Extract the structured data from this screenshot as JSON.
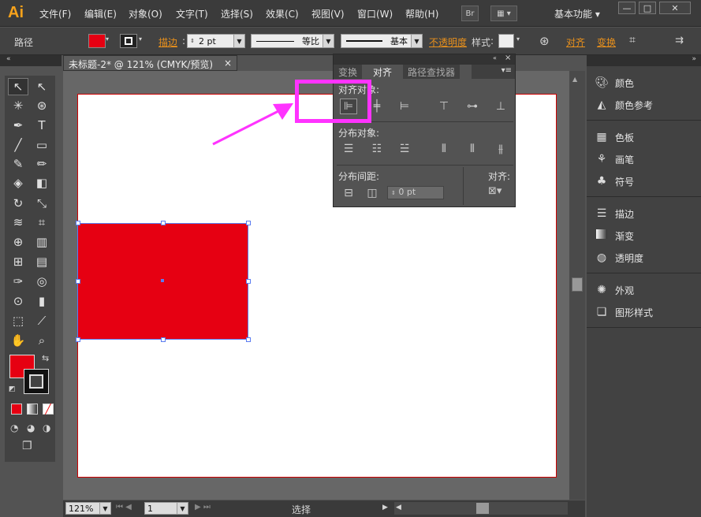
{
  "menubar": {
    "logo": "Ai",
    "menus": [
      "文件(F)",
      "编辑(E)",
      "对象(O)",
      "文字(T)",
      "选择(S)",
      "效果(C)",
      "视图(V)",
      "窗口(W)",
      "帮助(H)"
    ],
    "bridge_label": "Br",
    "workspace": "基本功能",
    "window_controls": [
      "—",
      "□",
      "✕"
    ]
  },
  "control_bar": {
    "selection_label": "路径",
    "fill_color": "#e60012",
    "stroke_label": "描边",
    "stroke_weight": "2 pt",
    "profile_label": "等比",
    "brush_label": "基本",
    "opacity_label": "不透明度",
    "style_label": "样式",
    "align_label": "对齐",
    "transform_label": "变换"
  },
  "document": {
    "tab_title": "未标题-2* @ 121% (CMYK/预览)",
    "zoom": "121%",
    "artboard_number": "1",
    "status_text": "选择"
  },
  "shape": {
    "fill": "#e60012",
    "selection_color": "#5b7cf0"
  },
  "align_panel": {
    "tabs": [
      "变换",
      "对齐",
      "路径查找器"
    ],
    "align_objects_label": "对齐对象:",
    "distribute_objects_label": "分布对象:",
    "distribute_spacing_label": "分布间距:",
    "align_to_label": "对齐:",
    "spacing_value": "0 pt"
  },
  "annotation": {
    "color": "#ff33ff"
  },
  "right_panel": {
    "groups": [
      [
        "颜色",
        "颜色参考"
      ],
      [
        "色板",
        "画笔",
        "符号"
      ],
      [
        "描边",
        "渐变",
        "透明度"
      ],
      [
        "外观",
        "图形样式"
      ]
    ]
  }
}
